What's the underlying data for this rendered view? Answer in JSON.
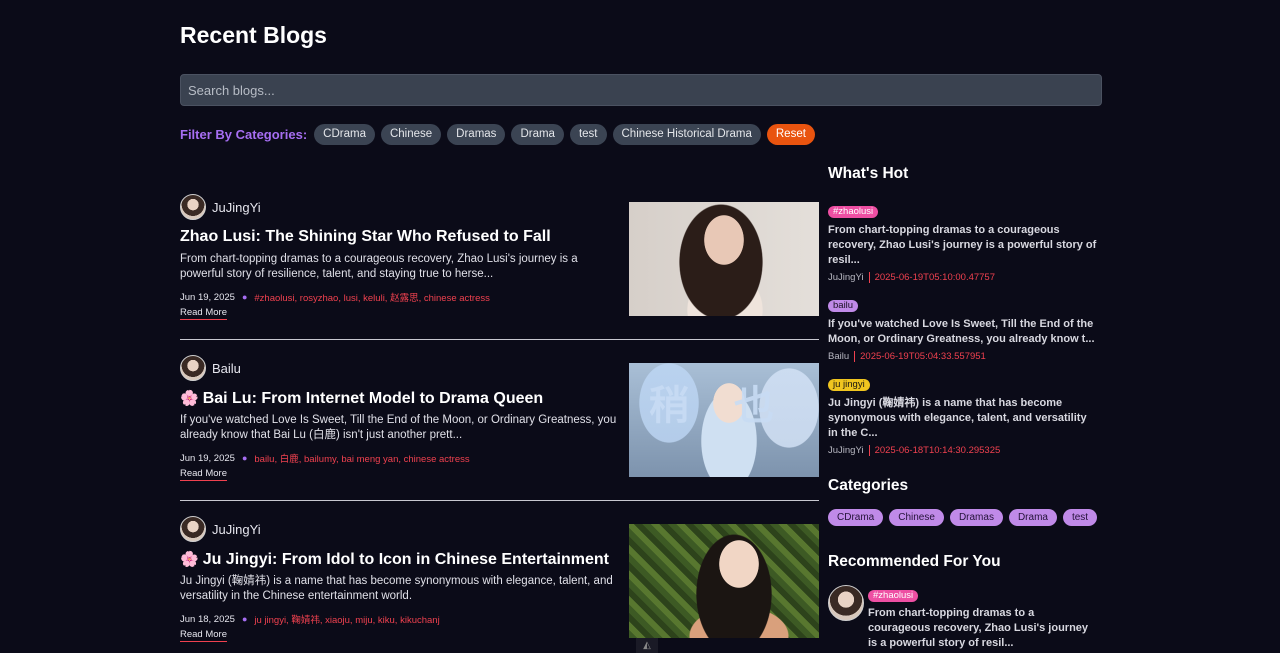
{
  "page": {
    "title": "Recent Blogs"
  },
  "search": {
    "placeholder": "Search blogs..."
  },
  "filter": {
    "label": "Filter By Categories:",
    "categories": [
      "CDrama",
      "Chinese",
      "Dramas",
      "Drama",
      "test",
      "Chinese Historical Drama"
    ],
    "reset_label": "Reset"
  },
  "posts": [
    {
      "author": "JuJingYi",
      "title": "Zhao Lusi: The Shining Star Who Refused to Fall",
      "flower": "",
      "excerpt": "From chart-topping dramas to a courageous recovery, Zhao Lusi's journey is a powerful story of resilience, talent, and staying true to herse...",
      "date": "Jun 19, 2025",
      "tags": "#zhaolusi, rosyzhao, lusi, keluli, 赵露思, chinese actress",
      "read_more": "Read More"
    },
    {
      "author": "Bailu",
      "title": "Bai Lu: From Internet Model to Drama Queen",
      "flower": "🌸",
      "excerpt": "If you've watched Love Is Sweet, Till the End of the Moon, or Ordinary Greatness, you already know that Bai Lu (白鹿) isn't just another prett...",
      "date": "Jun 19, 2025",
      "tags": "bailu, 白鹿, bailumy, bai meng yan, chinese actress",
      "read_more": "Read More",
      "thumb_text": "稍也"
    },
    {
      "author": "JuJingYi",
      "title": "Ju Jingyi: From Idol to Icon in Chinese Entertainment",
      "flower": "🌸",
      "excerpt": "Ju Jingyi (鞠婧祎) is a name that has become synonymous with elegance, talent, and versatility in the Chinese entertainment world.",
      "date": "Jun 18, 2025",
      "tags": "ju jingyi, 鞠婧祎, xiaoju, miju, kiku, kikuchanj",
      "read_more": "Read More"
    }
  ],
  "sidebar": {
    "hot_heading": "What's Hot",
    "hot": [
      {
        "tag": "#zhaolusi",
        "text": "From chart-topping dramas to a courageous recovery, Zhao Lusi's journey is a powerful story of resil...",
        "author": "JuJingYi",
        "date": "2025-06-19T05:10:00.47757"
      },
      {
        "tag": "bailu",
        "text": "If you've watched Love Is Sweet, Till the End of the Moon, or Ordinary Greatness, you already know t...",
        "author": "Bailu",
        "date": "2025-06-19T05:04:33.557951"
      },
      {
        "tag": "ju jingyi",
        "text": "Ju Jingyi (鞠婧祎) is a name that has become synonymous with elegance, talent, and versatility in the C...",
        "author": "JuJingYi",
        "date": "2025-06-18T10:14:30.295325"
      }
    ],
    "categories_heading": "Categories",
    "categories": [
      "CDrama",
      "Chinese",
      "Dramas",
      "Drama",
      "test"
    ],
    "recommended_heading": "Recommended For You",
    "recommended": {
      "tag": "#zhaolusi",
      "text": "From chart-topping dramas to a courageous recovery, Zhao Lusi's journey is a powerful story of resil..."
    }
  },
  "colors": {
    "background": "#0b0b18",
    "accent_purple": "#a66ef2",
    "tag_red": "#f0414f",
    "reset_orange": "#e9540f",
    "tag_pink": "#ee4fa3",
    "tag_yellow": "#f0c51f"
  }
}
